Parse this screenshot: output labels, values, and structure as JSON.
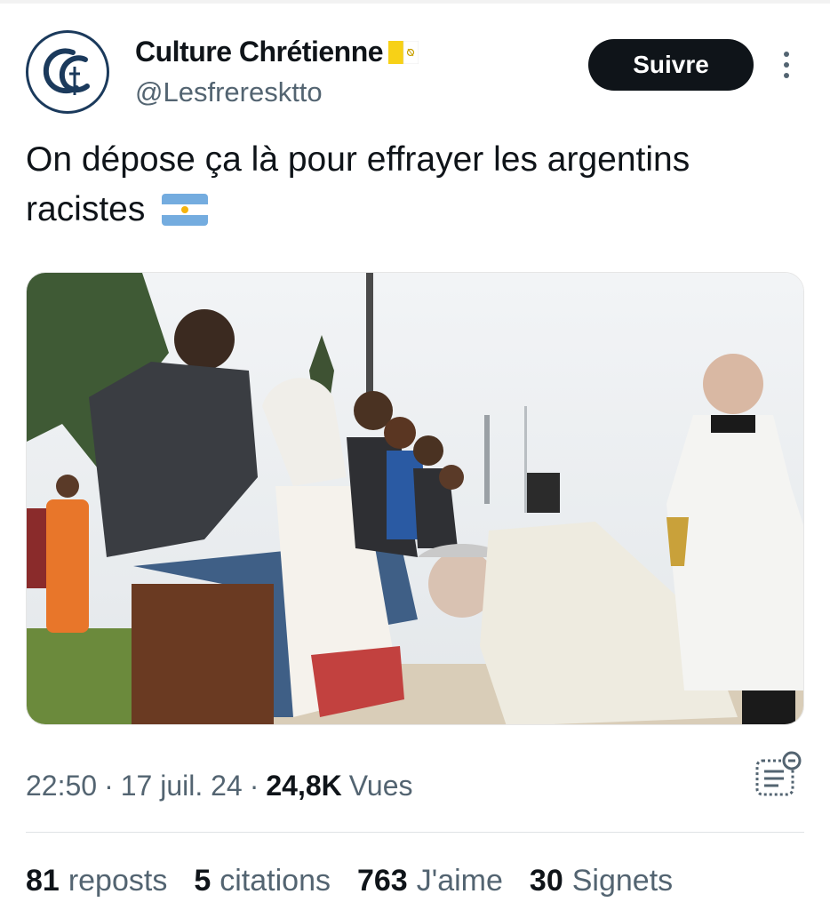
{
  "tweet": {
    "author": {
      "display_name": "Culture Chrétienne",
      "handle": "@Lesfreresktto",
      "name_badge_icon": "vatican-flag-icon",
      "avatar_letters": "CC",
      "avatar_color": "#1b3a5c"
    },
    "follow_label": "Suivre",
    "more_icon": "more-vertical-icon",
    "text": "On dépose ça là pour effrayer les argentins racistes",
    "text_emoji": "argentina-flag-icon",
    "media": {
      "type": "photo"
    },
    "timestamp": {
      "time": "22:50",
      "date": "17 juil. 24",
      "separator": "·",
      "views_count": "24,8K",
      "views_label": "Vues"
    },
    "analytics_icon": "analytics-icon",
    "stats": [
      {
        "count": "81",
        "label": "reposts"
      },
      {
        "count": "5",
        "label": "citations"
      },
      {
        "count": "763",
        "label": "J'aime"
      },
      {
        "count": "30",
        "label": "Signets"
      }
    ]
  },
  "colors": {
    "primary_text": "#0f1419",
    "secondary_text": "#536471",
    "follow_bg": "#0f1419",
    "divider": "#dfe3e6"
  }
}
